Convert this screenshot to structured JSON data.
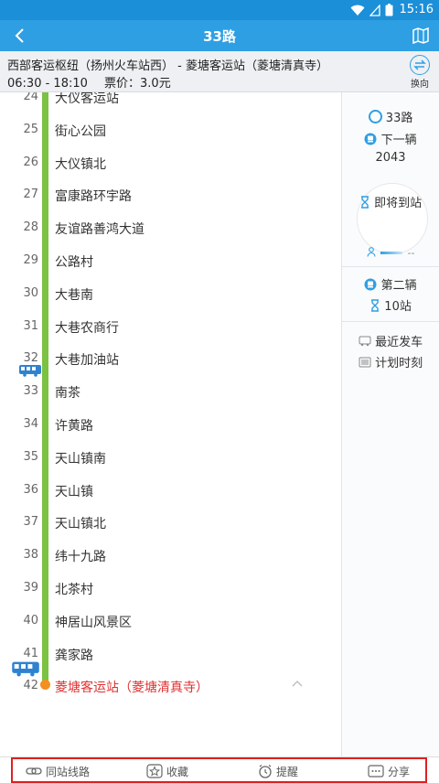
{
  "status_bar": {
    "time": "15:16",
    "icons": [
      "wifi-icon",
      "signal-icon",
      "battery-icon"
    ]
  },
  "app_bar": {
    "title": "33路",
    "back_icon": "chevron-left-icon",
    "map_icon": "map-icon"
  },
  "route_info": {
    "direction": "西部客运枢纽（扬州火车站西） - 菱塘客运站（菱塘清真寺）",
    "hours": "06:30 - 18:10",
    "fare": "票价：3.0元",
    "switch_label": "换向"
  },
  "stops": [
    {
      "num": "24",
      "name": "大仪客运站"
    },
    {
      "num": "25",
      "name": "街心公园"
    },
    {
      "num": "26",
      "name": "大仪镇北"
    },
    {
      "num": "27",
      "name": "富康路环宇路"
    },
    {
      "num": "28",
      "name": "友谊路善鸿大道"
    },
    {
      "num": "29",
      "name": "公路村"
    },
    {
      "num": "30",
      "name": "大巷南"
    },
    {
      "num": "31",
      "name": "大巷农商行"
    },
    {
      "num": "32",
      "name": "大巷加油站"
    },
    {
      "num": "33",
      "name": "南茶"
    },
    {
      "num": "34",
      "name": "许黄路"
    },
    {
      "num": "35",
      "name": "天山镇南"
    },
    {
      "num": "36",
      "name": "天山镇"
    },
    {
      "num": "37",
      "name": "天山镇北"
    },
    {
      "num": "38",
      "name": "纬十九路"
    },
    {
      "num": "39",
      "name": "北茶村"
    },
    {
      "num": "40",
      "name": "神居山风景区"
    },
    {
      "num": "41",
      "name": "龚家路"
    },
    {
      "num": "42",
      "name": "菱塘客运站（菱塘清真寺）"
    }
  ],
  "side_panel": {
    "route_name": "33路",
    "next_bus_label": "下一辆",
    "next_bus_id": "2043",
    "arriving_label": "即将到站",
    "crowd_value": "--",
    "second_bus_label": "第二辆",
    "second_bus_stops": "10站",
    "recent_departure": "最近发车",
    "schedule": "计划时刻"
  },
  "bottom_bar": {
    "same_stop_routes": "同站线路",
    "favorite": "收藏",
    "remind": "提醒",
    "share": "分享"
  },
  "colors": {
    "primary": "#2f9fe3",
    "route_rail": "#7cc242",
    "terminal": "#e03030",
    "highlight_frame": "#e02020"
  }
}
